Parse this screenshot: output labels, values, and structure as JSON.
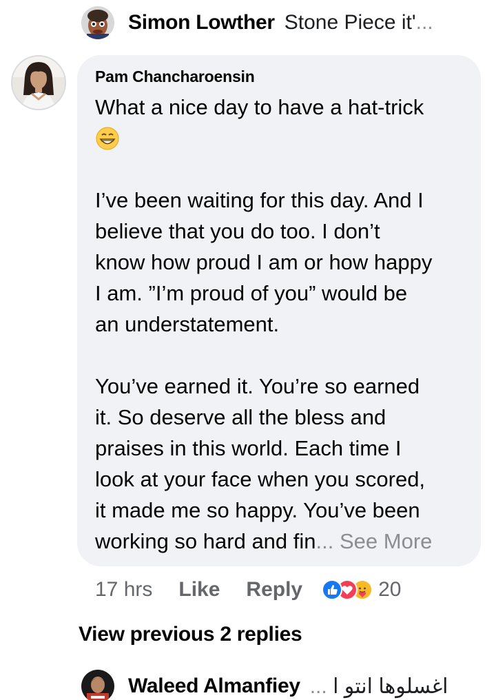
{
  "top_reply": {
    "name": "Simon Lowther",
    "snippet": "Stone Piece it'",
    "ellipsis": "..."
  },
  "comment": {
    "author": "Pam Chancharoensin",
    "line1": "What a nice day to have a hat-trick",
    "emoji": "grinning-face-emoji",
    "p2_l1": "I’ve been waiting for this day. And I",
    "p2_l2": "believe that you do too.  I don’t",
    "p2_l3": "know how proud I am or how happy",
    "p2_l4": "I am. ”I’m proud of you” would be",
    "p2_l5": "an understatement.",
    "p3_l1": "You’ve earned it. You’re so earned",
    "p3_l2": "it. So deserve all the bless and",
    "p3_l3": "praises in this world. Each time I",
    "p3_l4": "look at your face when you scored,",
    "p3_l5": "it made me so happy. You’ve been",
    "p3_l6": "working so hard and fin",
    "see_more": "... See More",
    "time": "17 hrs",
    "like_label": "Like",
    "reply_label": "Reply",
    "reaction_icons": [
      "like-reaction-icon",
      "love-reaction-icon",
      "care-reaction-icon"
    ],
    "reaction_count": "20"
  },
  "view_previous": "View previous 2 replies",
  "bottom_reply": {
    "name": "Waleed Almanfiey",
    "snippet": "اغسلوها انتو ا",
    "ellipsis": "..."
  },
  "colors": {
    "bubble": "#f0f2f5",
    "secondary_text": "#65676b",
    "like_blue": "#1877f2",
    "love_red": "#f33e58",
    "care_yellow": "#f7b928"
  }
}
